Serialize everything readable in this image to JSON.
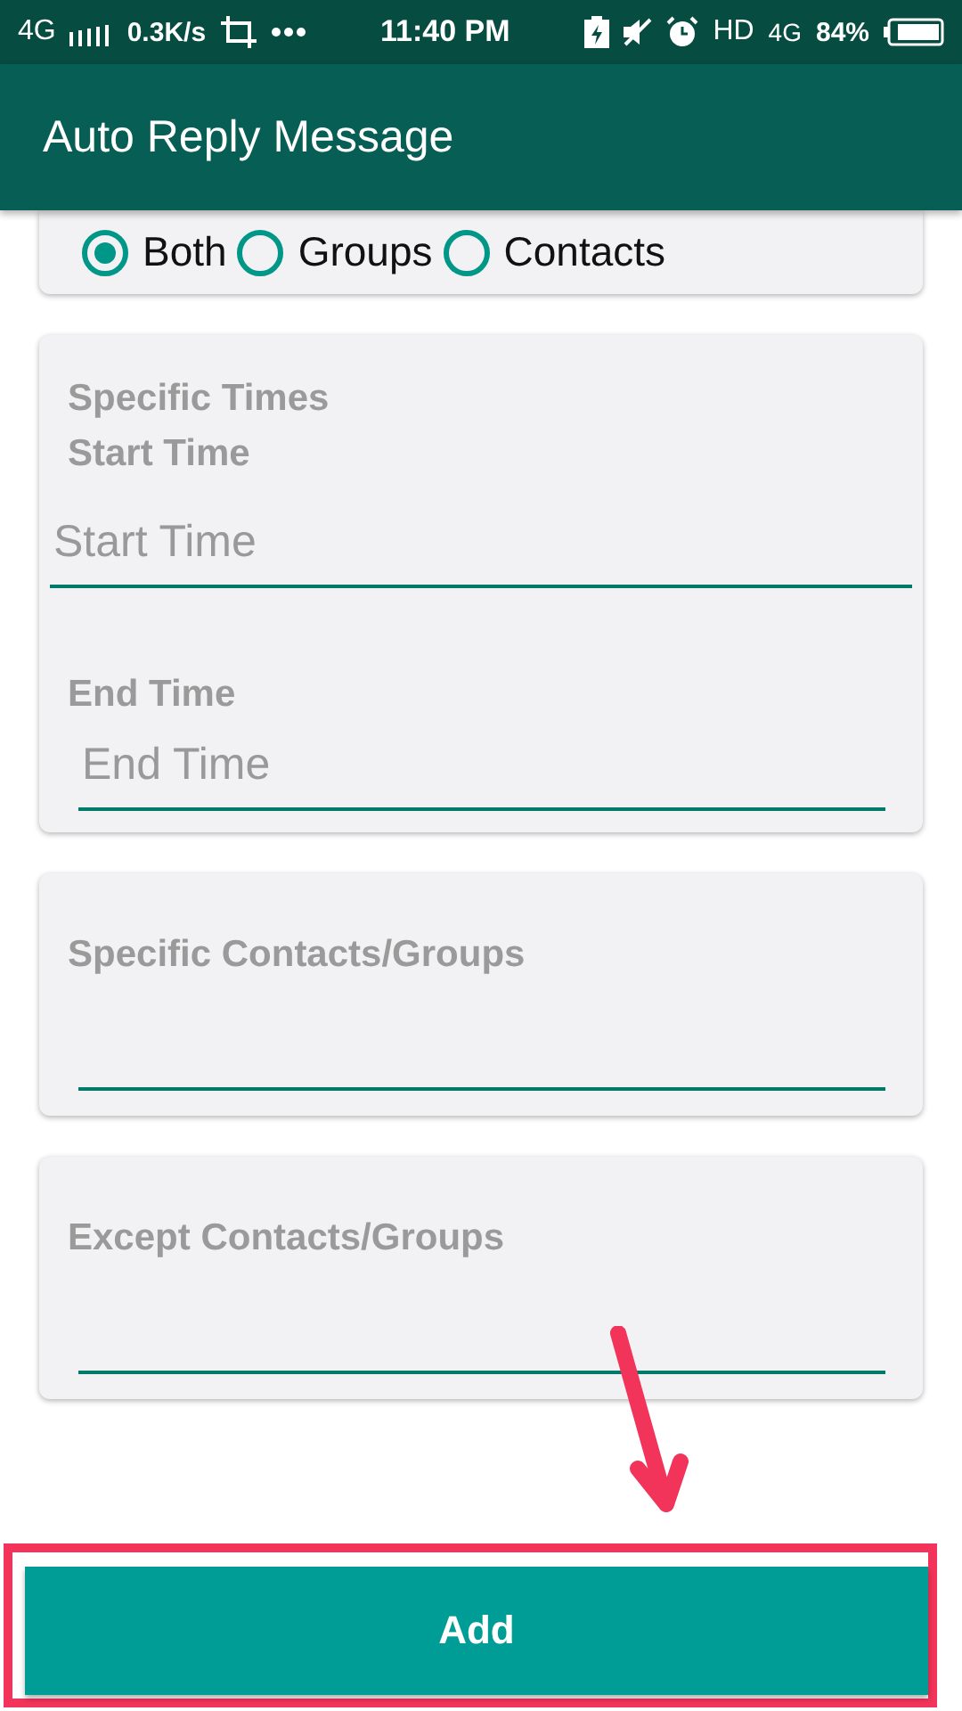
{
  "status_bar": {
    "network": "4G",
    "speed": "0.3K/s",
    "time": "11:40 PM",
    "hd": "HD",
    "network_2": "4G",
    "battery": "84%"
  },
  "app_bar": {
    "title": "Auto Reply Message"
  },
  "audience": [
    {
      "label": "Both",
      "selected": true
    },
    {
      "label": "Groups",
      "selected": false
    },
    {
      "label": "Contacts",
      "selected": false
    }
  ],
  "times_card": {
    "title": "Specific Times",
    "start_label": "Start Time",
    "start_placeholder": "Start Time",
    "end_label": "End Time",
    "end_placeholder": "End Time"
  },
  "contact_cards": [
    {
      "title": "Specific Contacts/Groups"
    },
    {
      "title": "Except Contacts/Groups"
    }
  ],
  "add_button": "Add"
}
